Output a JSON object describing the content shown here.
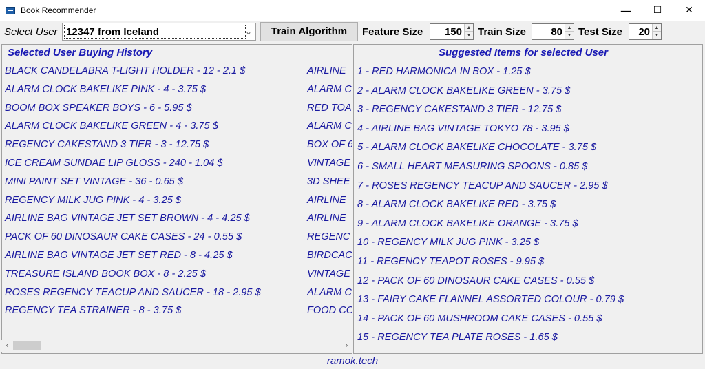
{
  "window": {
    "title": "Book Recommender",
    "icon": "app-icon",
    "controls": {
      "minimize": "—",
      "maximize": "☐",
      "close": "✕"
    }
  },
  "toolbar": {
    "select_user_label": "Select User",
    "selected_user": "12347 from Iceland",
    "train_button": "Train Algorithm",
    "feature_size_label": "Feature Size",
    "feature_size_value": "150",
    "train_size_label": "Train Size",
    "train_size_value": "80",
    "test_size_label": "Test Size",
    "test_size_value": "20"
  },
  "history": {
    "title": "Selected User Buying History",
    "col1": [
      "BLACK CANDELABRA T-LIGHT HOLDER - 12 - 2.1 $",
      "ALARM CLOCK BAKELIKE PINK - 4 - 3.75 $",
      "BOOM BOX SPEAKER BOYS - 6 - 5.95 $",
      "ALARM CLOCK BAKELIKE GREEN - 4 - 3.75 $",
      "REGENCY CAKESTAND 3 TIER - 3 - 12.75 $",
      "ICE CREAM SUNDAE LIP GLOSS - 240 - 1.04 $",
      "MINI PAINT SET VINTAGE  - 36 - 0.65 $",
      "REGENCY MILK JUG PINK  - 4 - 3.25 $",
      "AIRLINE BAG VINTAGE JET SET BROWN - 4 - 4.25 $",
      "PACK OF 60 DINOSAUR CAKE CASES - 24 - 0.55 $",
      "AIRLINE BAG VINTAGE JET SET RED - 8 - 4.25 $",
      "TREASURE ISLAND BOOK BOX - 8 - 2.25 $",
      "ROSES REGENCY TEACUP AND SAUCER  - 18 - 2.95 $",
      "REGENCY TEA STRAINER - 8 - 3.75 $"
    ],
    "col2": [
      "AIRLINE",
      "ALARM C",
      "RED TOA",
      "ALARM C",
      "BOX OF 6",
      "VINTAGE",
      "3D SHEE",
      "AIRLINE",
      "AIRLINE",
      "REGENC",
      "BIRDCAC",
      "VINTAGE",
      "ALARM C",
      "FOOD CO"
    ]
  },
  "suggestions": {
    "title": "Suggested Items for selected User",
    "items": [
      "1 - RED  HARMONICA IN BOX  - 1.25 $",
      "2 - ALARM CLOCK BAKELIKE GREEN - 3.75 $",
      "3 - REGENCY CAKESTAND 3 TIER - 12.75 $",
      "4 - AIRLINE BAG VINTAGE TOKYO 78 - 3.95 $",
      "5 - ALARM CLOCK BAKELIKE CHOCOLATE - 3.75 $",
      "6 - SMALL HEART MEASURING SPOONS - 0.85 $",
      "7 - ROSES REGENCY TEACUP AND SAUCER  - 2.95 $",
      "8 - ALARM CLOCK BAKELIKE RED  - 3.75 $",
      "9 - ALARM CLOCK BAKELIKE ORANGE - 3.75 $",
      "10 - REGENCY MILK JUG PINK  - 3.25 $",
      "11 - REGENCY TEAPOT ROSES  - 9.95 $",
      "12 - PACK OF 60 DINOSAUR CAKE CASES - 0.55 $",
      "13 - FAIRY CAKE FLANNEL ASSORTED COLOUR - 0.79 $",
      "14 - PACK OF 60 MUSHROOM CAKE CASES - 0.55 $",
      "15 - REGENCY TEA PLATE ROSES  - 1.65 $"
    ]
  },
  "footer": {
    "text": "ramok.tech"
  },
  "colors": {
    "list_text": "#1a1aa0",
    "heading_text": "#1a1ab4",
    "background": "#f0f0f0"
  }
}
